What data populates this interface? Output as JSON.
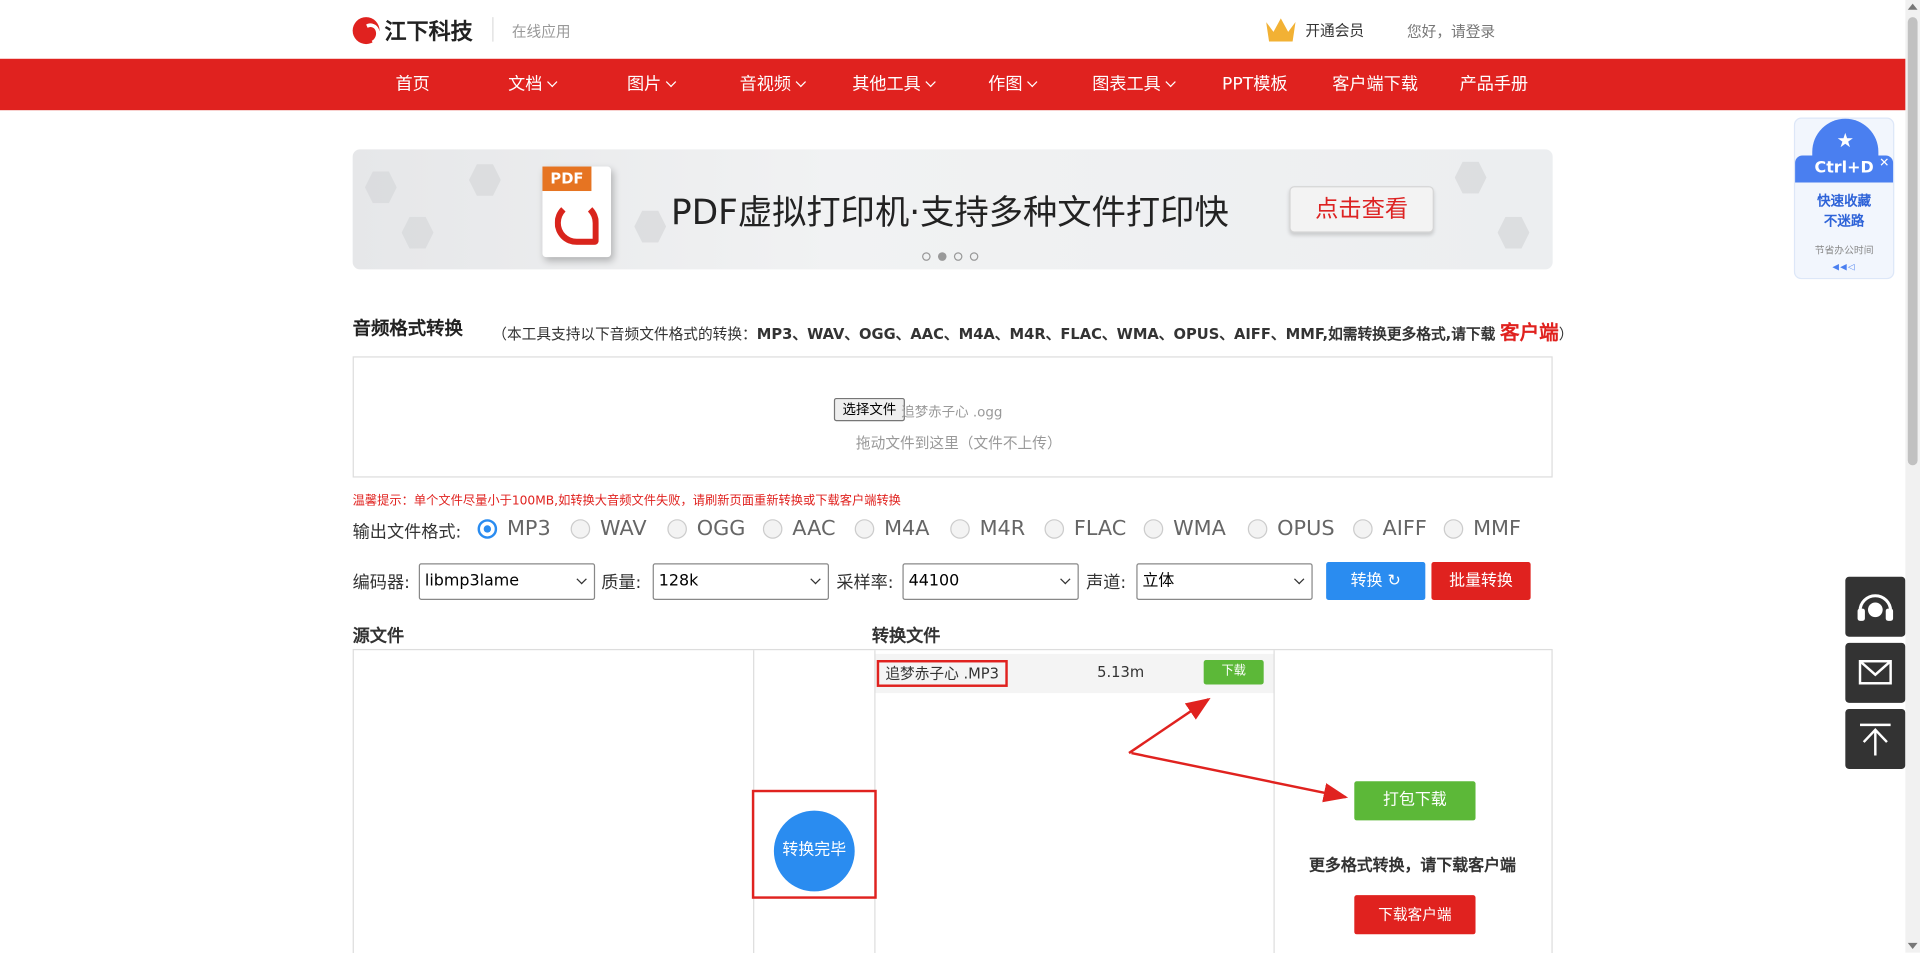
{
  "header": {
    "logo_text": "江下科技",
    "subtitle": "在线应用",
    "vip_label": "开通会员",
    "login_label": "您好，请登录"
  },
  "nav": [
    {
      "label": "首页"
    },
    {
      "label": "文档"
    },
    {
      "label": "图片"
    },
    {
      "label": "音视频"
    },
    {
      "label": "其他工具"
    },
    {
      "label": "作图"
    },
    {
      "label": "图表工具"
    },
    {
      "label": "PPT模板"
    },
    {
      "label": "客户端下载"
    },
    {
      "label": "产品手册"
    }
  ],
  "banner": {
    "pdf_tag": "PDF",
    "title": "PDF虚拟打印机·支持多种文件打印快",
    "button": "点击查看"
  },
  "section": {
    "title": "音频格式转换",
    "note_prefix": "（本工具支持以下音频文件格式的转换：",
    "note_formats": "MP3、WAV、OGG、AAC、M4A、M4R、FLAC、WMA、OPUS、AIFF、MMF,如需转换更多格式,请下载",
    "note_client": "客户端",
    "note_suffix": "）"
  },
  "upload": {
    "choose_button": "选择文件",
    "file_name": "追梦赤子心 .ogg",
    "drop_hint": "拖动文件到这里（文件不上传）"
  },
  "warning": "温馨提示：单个文件尽量小于100MB,如转换大音频文件失败，请刷新页面重新转换或下载客户端转换",
  "formats": {
    "label": "输出文件格式:",
    "options": [
      "MP3",
      "WAV",
      "OGG",
      "AAC",
      "M4A",
      "M4R",
      "FLAC",
      "WMA",
      "OPUS",
      "AIFF",
      "MMF"
    ],
    "selected": "MP3"
  },
  "settings": {
    "encoder_label": "编码器:",
    "encoder_value": "libmp3lame",
    "quality_label": "质量:",
    "quality_value": "128k",
    "samplerate_label": "采样率:",
    "samplerate_value": "44100",
    "channel_label": "声道:",
    "channel_value": "立体",
    "convert_button": "转换",
    "batch_button": "批量转换"
  },
  "panels": {
    "source_title": "源文件",
    "output_title": "转换文件",
    "output_file": "追梦赤子心 .MP3",
    "output_size": "5.13m",
    "download_button": "下载",
    "done_label": "转换完毕",
    "pack_button": "打包下载",
    "more_text": "更多格式转换，请下载客户端",
    "client_button": "下载客户端"
  },
  "side_widget": {
    "shortcut": "Ctrl+D",
    "line1": "快速收藏",
    "line2": "不迷路",
    "line3": "节省办公时间"
  },
  "colors": {
    "brand_red": "#e0221f",
    "accent_blue": "#2a8cf0",
    "success_green": "#5cb838"
  }
}
